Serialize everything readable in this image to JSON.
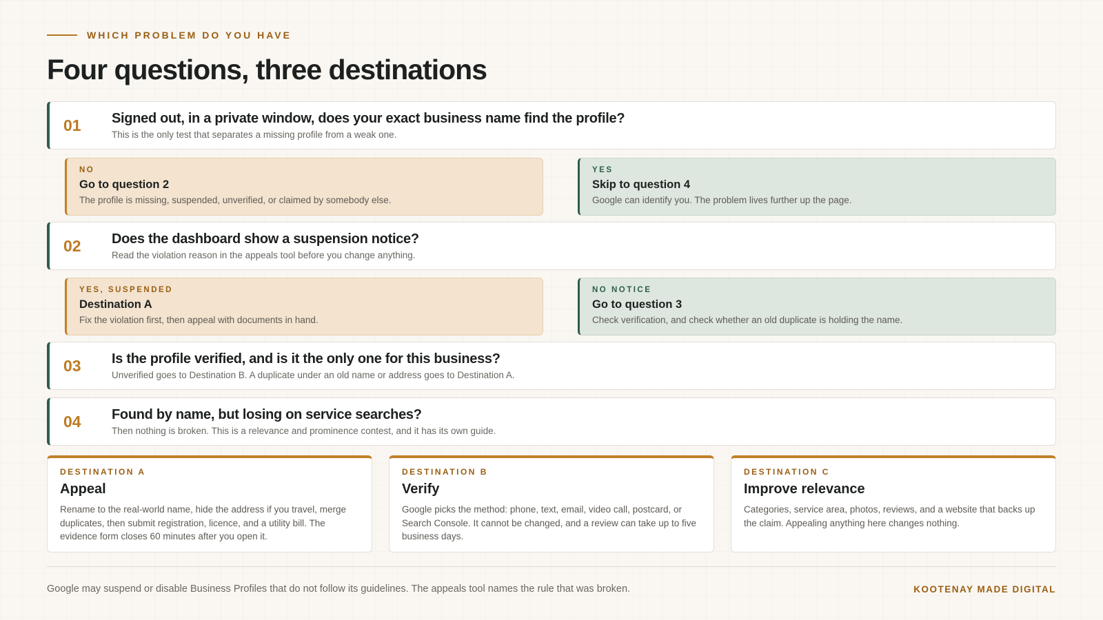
{
  "header": {
    "eyebrow": "WHICH PROBLEM DO YOU HAVE",
    "title": "Four questions, three destinations"
  },
  "questions": [
    {
      "num": "01",
      "title": "Signed out, in a private window, does your exact business name find the profile?",
      "sub": "This is the only test that separates a missing profile from a weak one.",
      "answers": [
        {
          "tag": "NO",
          "title": "Go to question 2",
          "sub": "The profile is missing, suspended, unverified, or claimed by somebody else."
        },
        {
          "tag": "YES",
          "title": "Skip to question 4",
          "sub": "Google can identify you. The problem lives further up the page."
        }
      ]
    },
    {
      "num": "02",
      "title": "Does the dashboard show a suspension notice?",
      "sub": "Read the violation reason in the appeals tool before you change anything.",
      "answers": [
        {
          "tag": "YES, SUSPENDED",
          "title": "Destination A",
          "sub": "Fix the violation first, then appeal with documents in hand."
        },
        {
          "tag": "NO NOTICE",
          "title": "Go to question 3",
          "sub": "Check verification, and check whether an old duplicate is holding the name."
        }
      ]
    },
    {
      "num": "03",
      "title": "Is the profile verified, and is it the only one for this business?",
      "sub": "Unverified goes to Destination B. A duplicate under an old name or address goes to Destination A."
    },
    {
      "num": "04",
      "title": "Found by name, but losing on service searches?",
      "sub": "Then nothing is broken. This is a relevance and prominence contest, and it has its own guide."
    }
  ],
  "destinations": [
    {
      "tag": "DESTINATION A",
      "title": "Appeal",
      "text": "Rename to the real-world name, hide the address if you travel, merge duplicates, then submit registration, licence, and a utility bill. The evidence form closes 60 minutes after you open it."
    },
    {
      "tag": "DESTINATION B",
      "title": "Verify",
      "text": "Google picks the method: phone, text, email, video call, postcard, or Search Console. It cannot be changed, and a review can take up to five business days."
    },
    {
      "tag": "DESTINATION C",
      "title": "Improve relevance",
      "text": "Categories, service area, photos, reviews, and a website that backs up the claim. Appealing anything here changes nothing."
    }
  ],
  "footer": {
    "note": "Google may suspend or disable Business Profiles that do not follow its guidelines. The appeals tool names the rule that was broken.",
    "brand": "KOOTENAY MADE DIGITAL"
  },
  "colors": {
    "accent_amber": "#c27f29",
    "accent_green": "#2e5d49",
    "no_card_bg": "#f3e3cf",
    "yes_card_bg": "#dde7df",
    "page_bg": "#faf7f2"
  }
}
